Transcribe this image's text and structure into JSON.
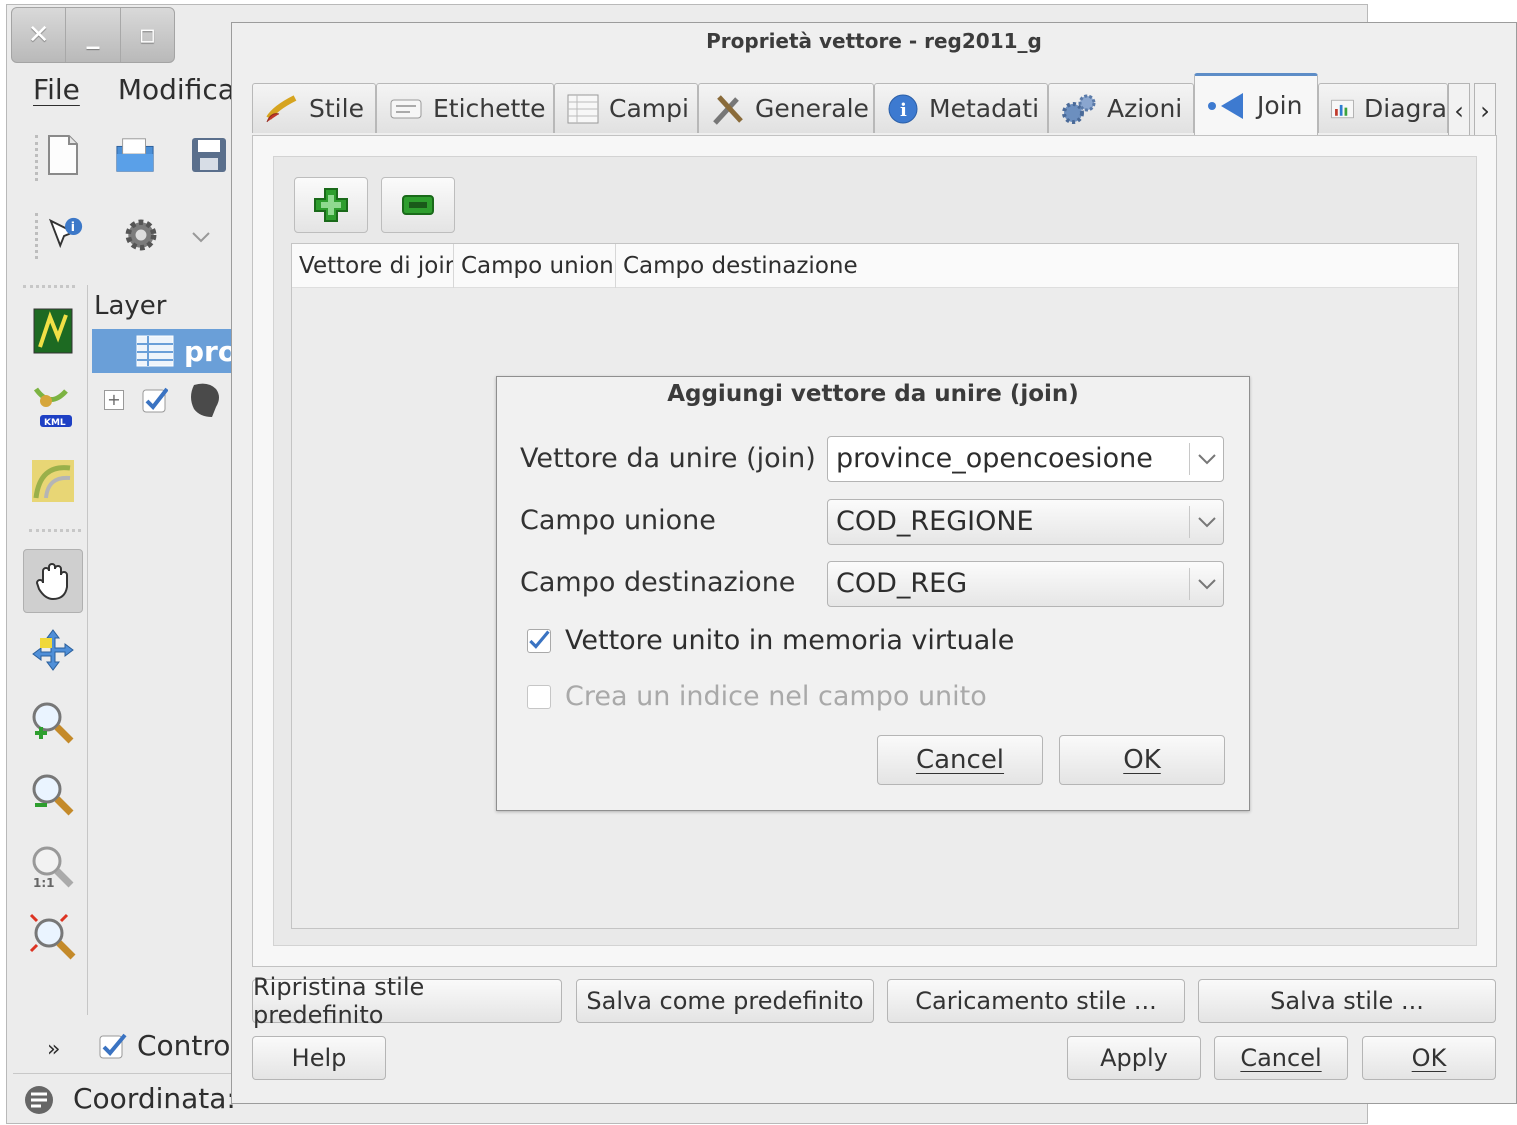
{
  "main_window": {
    "menu": [
      "File",
      "Modifica"
    ],
    "layer_panel_title": "Layer",
    "selected_layer": "pro",
    "control_label": "Control",
    "status_coord_label": "Coordinata:"
  },
  "props_dialog": {
    "title": "Proprietà vettore - reg2011_g",
    "tabs": [
      "Stile",
      "Etichette",
      "Campi",
      "Generale",
      "Metadati",
      "Azioni",
      "Join",
      "Diagra"
    ],
    "active_tab": "Join",
    "join_table_headers": [
      "Vettore di joir",
      "Campo unione",
      "Campo destinazione"
    ],
    "bottom_row1": [
      "Ripristina stile predefinito",
      "Salva come predefinito",
      "Caricamento stile ...",
      "Salva stile ..."
    ],
    "bottom_row2": {
      "help": "Help",
      "apply": "Apply",
      "cancel": "Cancel",
      "ok": "OK"
    }
  },
  "join_dialog": {
    "title": "Aggiungi vettore da unire (join)",
    "fields": [
      {
        "label": "Vettore da unire (join)",
        "value": "province_opencoesione"
      },
      {
        "label": "Campo unione",
        "value": "COD_REGIONE"
      },
      {
        "label": "Campo destinazione",
        "value": "COD_REG"
      }
    ],
    "checkbox_memory": {
      "label": "Vettore unito in memoria virtuale",
      "checked": true
    },
    "checkbox_index": {
      "label": "Crea un indice nel campo unito",
      "checked": false,
      "enabled": false
    },
    "cancel": "Cancel",
    "ok": "OK"
  },
  "colors": {
    "accent": "#5d8dc7",
    "selection": "#6a9fd8",
    "add_green": "#2e9e2e"
  },
  "icons": [
    "close-icon",
    "minimize-icon",
    "maximize-icon",
    "new-file-icon",
    "open-folder-icon",
    "save-icon",
    "identify-icon",
    "gear-icon",
    "pan-hand-icon",
    "zoom-in-icon",
    "zoom-out-icon",
    "add-join-icon",
    "remove-join-icon",
    "chevron-down-icon"
  ]
}
